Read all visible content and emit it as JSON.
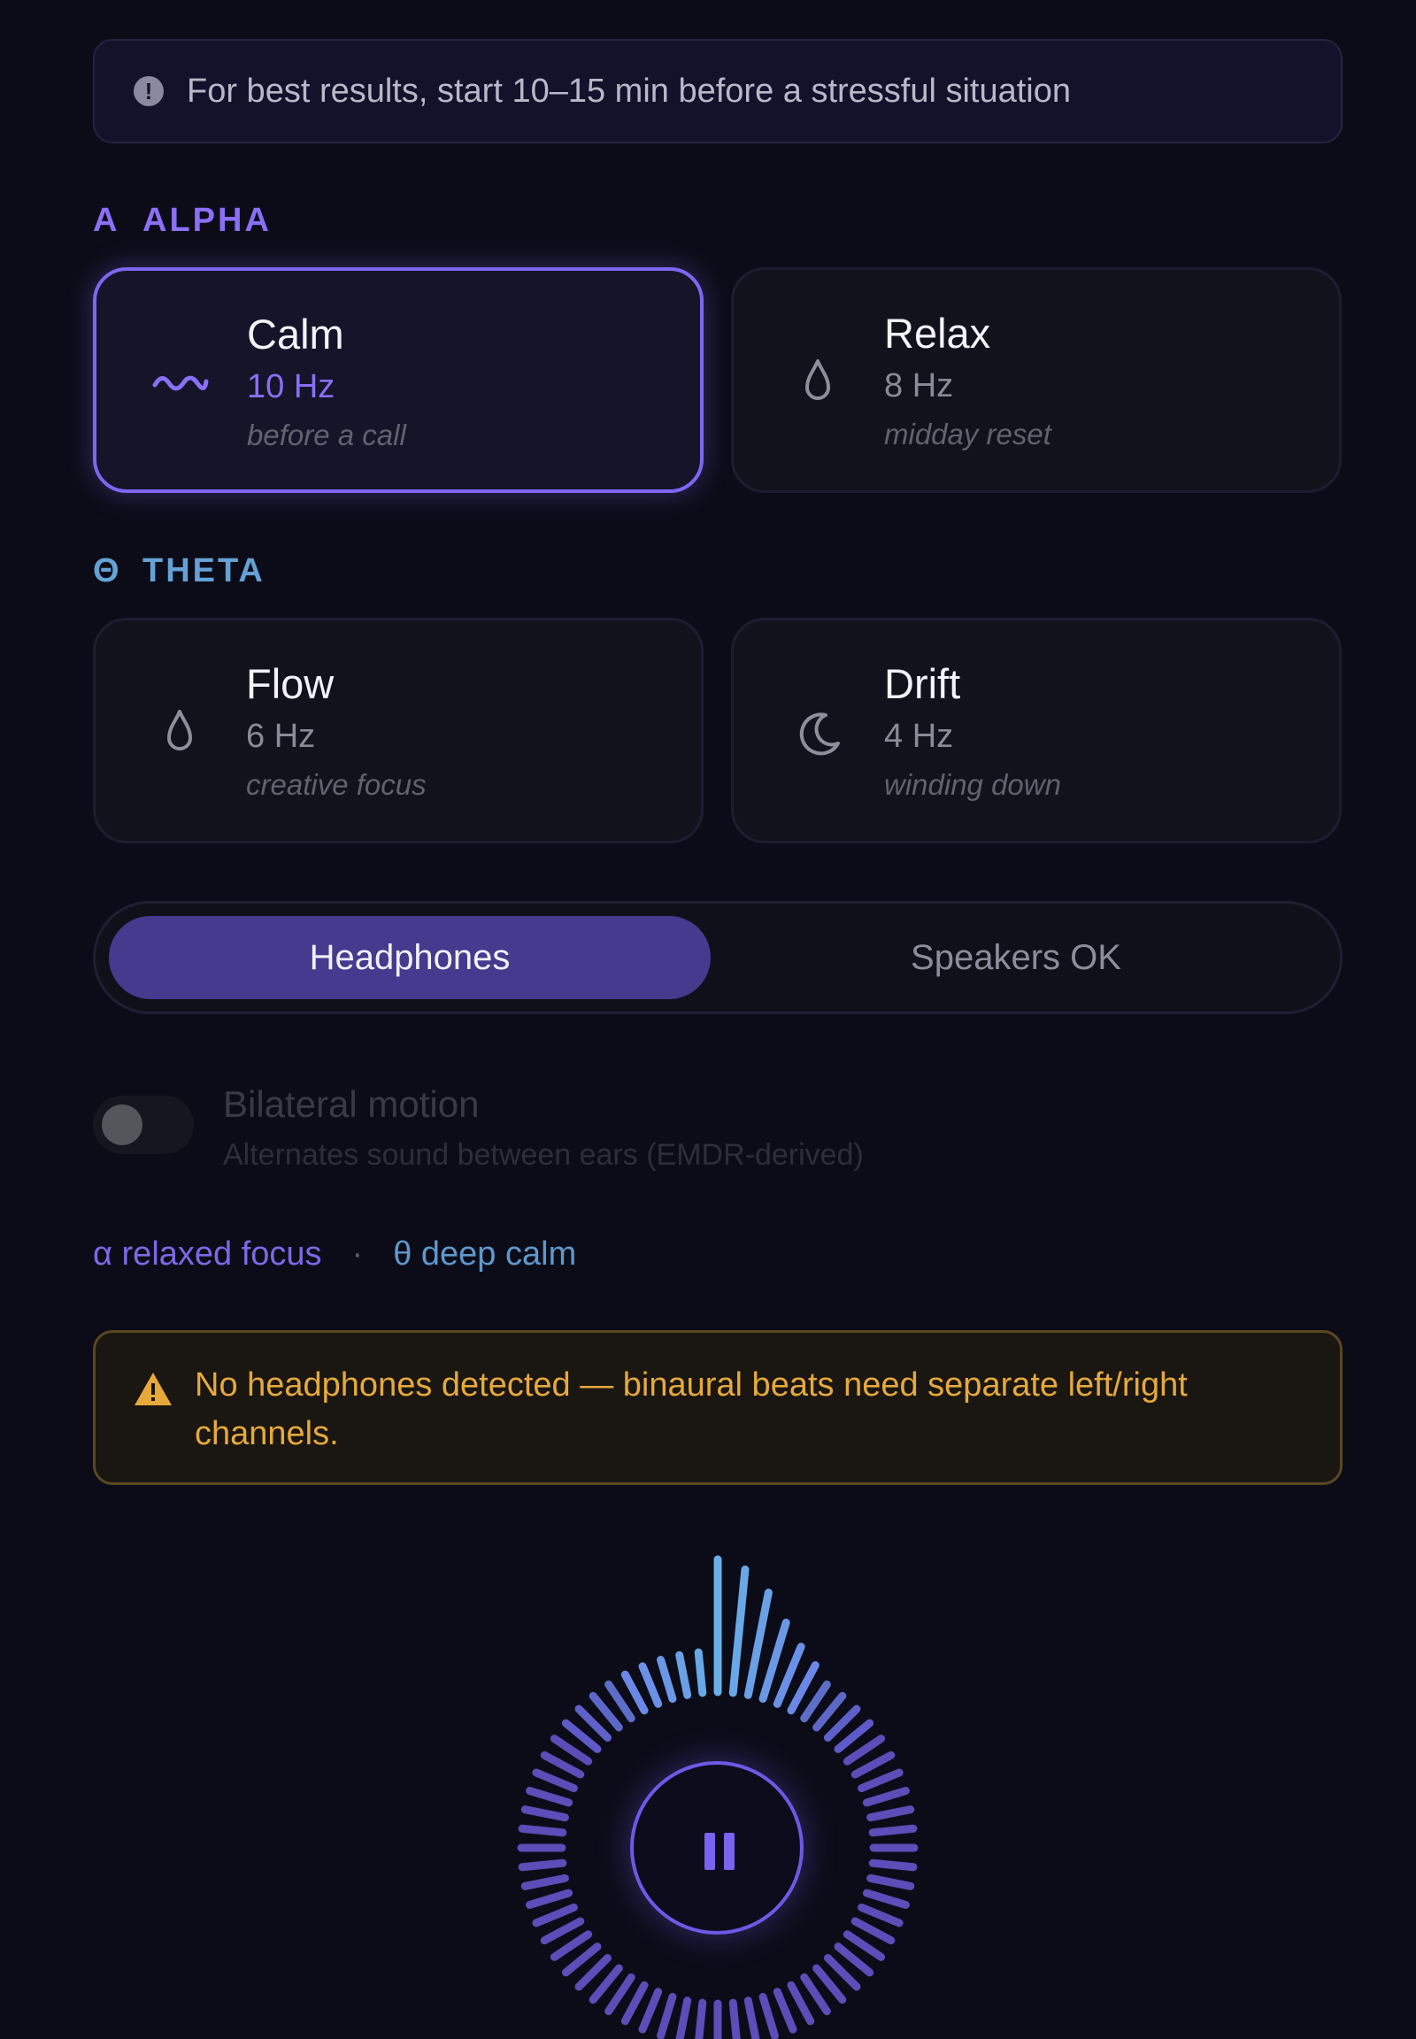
{
  "tip": {
    "icon": "info-circle-icon",
    "text": "For best results, start 10–15 min before a stressful situation"
  },
  "sections": {
    "alpha": {
      "glyph": "A",
      "label": "ALPHA",
      "color": "#8a6ff7",
      "cards": [
        {
          "title": "Calm",
          "hz": "10 Hz",
          "note": "before a call",
          "icon": "wave-icon",
          "selected": true
        },
        {
          "title": "Relax",
          "hz": "8 Hz",
          "note": "midday reset",
          "icon": "droplet-icon",
          "selected": false
        }
      ]
    },
    "theta": {
      "glyph": "Θ",
      "label": "THETA",
      "color": "#64a2d6",
      "cards": [
        {
          "title": "Flow",
          "hz": "6 Hz",
          "note": "creative focus",
          "icon": "droplet-icon",
          "selected": false
        },
        {
          "title": "Drift",
          "hz": "4 Hz",
          "note": "winding down",
          "icon": "moon-icon",
          "selected": false
        }
      ]
    }
  },
  "output_mode": {
    "options": [
      "Headphones",
      "Speakers OK"
    ],
    "selected": "Headphones"
  },
  "bilateral": {
    "title": "Bilateral motion",
    "subtitle": "Alternates sound between ears (EMDR-derived)",
    "enabled": false
  },
  "legend": {
    "alpha": "α relaxed focus",
    "separator": "·",
    "theta": "θ deep calm"
  },
  "warning": {
    "icon": "warning-triangle-icon",
    "text": "No headphones detected — binaural beats need separate left/right channels.",
    "color": "#e6a93b"
  },
  "player": {
    "state": "playing",
    "button_icon": "pause-icon",
    "accent": "#7a63f0"
  }
}
